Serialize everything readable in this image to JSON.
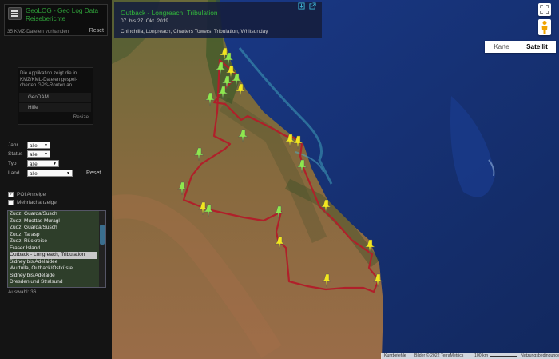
{
  "app": {
    "title_line1": "GeoLOG - Geo Log Data",
    "title_line2": "Reiseberichte",
    "count_text": "35 KMZ-Dateien vorhanden",
    "reset_label": "Reset"
  },
  "info": {
    "text_line1": "Die Applikation zeigt die in",
    "text_line2": "KMZ/KML-Dateien gespei-",
    "text_line3": "cherten GPS-Routen an.",
    "link1": "GeoDAM",
    "link2": "Hilfe",
    "resize_label": "Resize"
  },
  "filters": {
    "jahr_label": "Jahr",
    "jahr_value": "alle",
    "status_label": "Status",
    "status_value": "alle",
    "typ_label": "Typ",
    "typ_value": "alle",
    "land_label": "Land",
    "land_value": "alle",
    "reset_label": "Reset"
  },
  "options": {
    "poi_label": "POI Anzeige",
    "poi_checked": true,
    "multi_label": "Mehrfachanzeige",
    "multi_checked": false
  },
  "list": {
    "items": [
      "Zuoz, Guarda/Susch",
      "Zuoz, Muottas Muragl",
      "Zuoz, Guarda/Susch",
      "Zuoz, Tarasp",
      "Zuoz, Rückreise",
      "Fraser Island",
      "Outback - Longreach, Tribulation",
      "Sidney bis Adelaidee",
      "Wurtulla, Outback/Ostküste",
      "Sidney bis Adelaide",
      "Dresden und Stralsund"
    ],
    "selected_index": 6,
    "selection_text": "Auswahl: 36"
  },
  "route": {
    "title": "Outback - Longreach, Tribulation",
    "date": "07. bis 27. Okt. 2019",
    "places": "Chinchilla, Longreach, Charters Towers, Tribulation, Whitsunday"
  },
  "map": {
    "type_map_label": "Karte",
    "type_satellite_label": "Satellit",
    "active_type": "Satellit",
    "attribution": {
      "shortcuts": "Kurzbefehle",
      "imagery": "Bilder © 2022 TerraMetrics",
      "scale": "100 km",
      "terms": "Nutzungsbedingungen"
    },
    "route_color": "#b0202a",
    "icons": [
      "fullscreen-icon",
      "pegman-icon",
      "export-icon",
      "external-link-icon"
    ]
  },
  "colors": {
    "accent_green": "#2fa13a",
    "panel_bg": "#141414",
    "ocean": "#15306e"
  }
}
